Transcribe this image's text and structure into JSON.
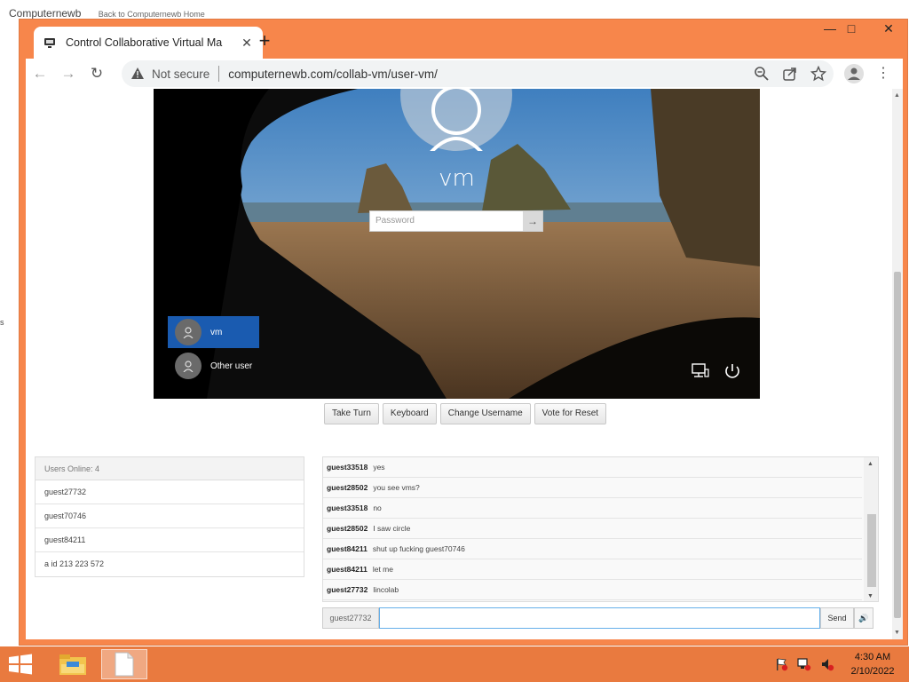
{
  "background": {
    "brand": "Computernewb",
    "back_link": "Back to Computernewb Home",
    "side_stub": "s"
  },
  "browser": {
    "tab_title": "Control Collaborative Virtual Ma",
    "address": {
      "security": "Not secure",
      "url": "computernewb.com/collab-vm/user-vm/"
    }
  },
  "vm": {
    "username": "vm",
    "password_placeholder": "Password",
    "users": [
      {
        "name": "vm",
        "selected": true
      },
      {
        "name": "Other user",
        "selected": false
      }
    ]
  },
  "controls": {
    "take_turn": "Take Turn",
    "keyboard": "Keyboard",
    "change_username": "Change Username",
    "vote_reset": "Vote for Reset"
  },
  "users_panel": {
    "header": "Users Online: 4",
    "users": [
      "guest27732",
      "guest70746",
      "guest84211",
      "a id 213 223 572"
    ]
  },
  "chat": {
    "messages": [
      {
        "user": "guest33518",
        "text": "yes"
      },
      {
        "user": "guest28502",
        "text": "you see vms?"
      },
      {
        "user": "guest33518",
        "text": "no"
      },
      {
        "user": "guest28502",
        "text": "I saw circle"
      },
      {
        "user": "guest84211",
        "text": "shut up fucking guest70746"
      },
      {
        "user": "guest84211",
        "text": "let me"
      },
      {
        "user": "guest27732",
        "text": "lincolab"
      }
    ],
    "current_user": "guest27732",
    "input_value": "",
    "send_label": "Send"
  },
  "taskbar": {
    "time": "4:30 AM",
    "date": "2/10/2022"
  },
  "colors": {
    "window_frame": "#f7864b",
    "taskbar": "#e97a3f",
    "selected_user": "#1a5bb0"
  }
}
